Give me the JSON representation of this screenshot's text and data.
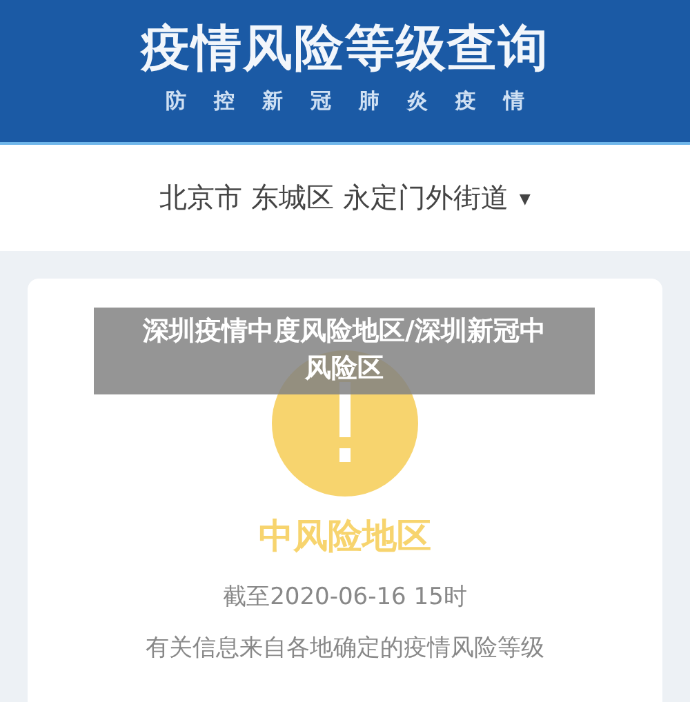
{
  "header": {
    "title": "疫情风险等级查询",
    "subtitle": [
      "防",
      "控",
      "新",
      "冠",
      "肺",
      "炎",
      "疫",
      "情"
    ]
  },
  "location": {
    "value": "北京市 东城区 永定门外街道",
    "dropdown": "▾"
  },
  "result": {
    "kind": "medium",
    "label": "中风险地区",
    "as_of": "截至2020-06-16 15时",
    "note": "有关信息来自各地确定的疫情风险等级"
  },
  "overlay_caption": "深圳疫情中度风险地区/深圳新冠中风险区"
}
